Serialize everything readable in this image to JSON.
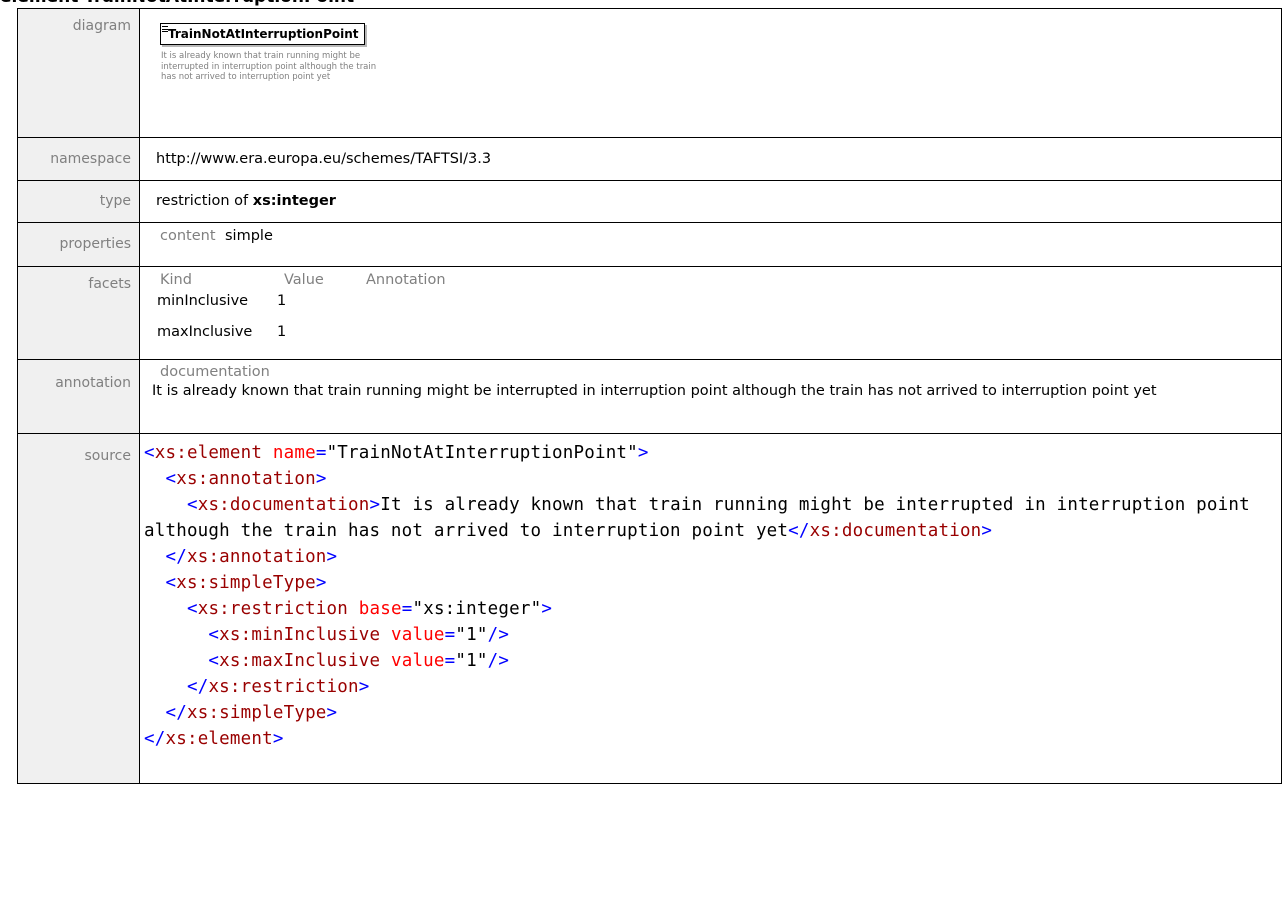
{
  "title": "element TrainNotAtInterruptionPoint",
  "rows": {
    "diagram": {
      "label": "diagram",
      "element_name": "TrainNotAtInterruptionPoint",
      "caption": "It is already known that train running might be interrupted in interruption point although the train has not arrived to interruption point yet"
    },
    "namespace": {
      "label": "namespace",
      "value": "http://www.era.europa.eu/schemes/TAFTSI/3.3"
    },
    "type": {
      "label": "type",
      "prefix": "restriction of ",
      "base": "xs:integer"
    },
    "properties": {
      "label": "properties",
      "name": "content",
      "value": "simple"
    },
    "facets": {
      "label": "facets",
      "headers": [
        "Kind",
        "Value",
        "Annotation"
      ],
      "rows": [
        {
          "kind": "minInclusive",
          "value": "1",
          "annotation": ""
        },
        {
          "kind": "maxInclusive",
          "value": "1",
          "annotation": ""
        }
      ]
    },
    "annotation": {
      "label": "annotation",
      "doc_label": "documentation",
      "text": "It is already known that train running might be interrupted in interruption point although the train has not arrived to interruption point yet"
    },
    "source": {
      "label": "source",
      "element_tag": "xs:element",
      "name_attr": "name",
      "name_value": "\"TrainNotAtInterruptionPoint\"",
      "annotation_tag": "xs:annotation",
      "documentation_tag": "xs:documentation",
      "documentation_text": "It is already known that train running might be interrupted in interruption point although the train has not arrived to interruption point yet",
      "simpletype_tag": "xs:simpleType",
      "restriction_tag": "xs:restriction",
      "base_attr": "base",
      "base_value": "\"xs:integer\"",
      "min_tag": "xs:minInclusive",
      "max_tag": "xs:maxInclusive",
      "value_attr": "value",
      "min_value": "\"1\"",
      "max_value": "\"1\""
    }
  }
}
